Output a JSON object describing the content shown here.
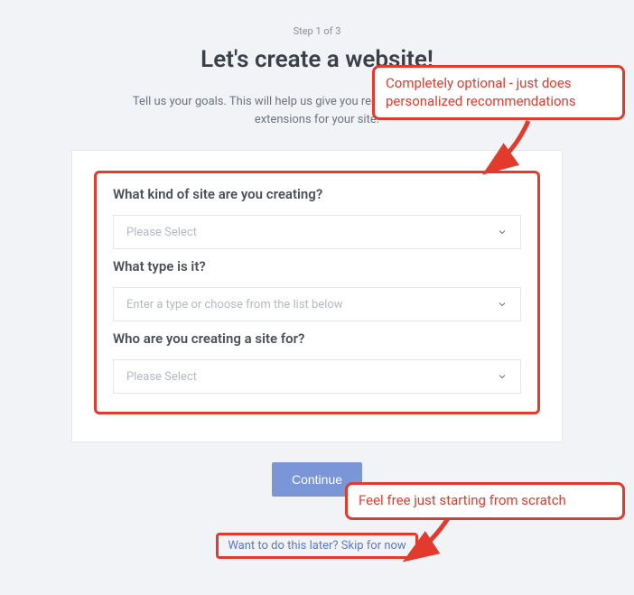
{
  "step_indicator": "Step 1 of 3",
  "page_title": "Let's create a website!",
  "page_subtitle": "Tell us your goals. This will help us give you recommended themes and extensions for your site.",
  "form": {
    "q1": {
      "label": "What kind of site are you creating?",
      "placeholder": "Please Select"
    },
    "q2": {
      "label": "What type is it?",
      "placeholder": "Enter a type or choose from the list below"
    },
    "q3": {
      "label": "Who are you creating a site for?",
      "placeholder": "Please Select"
    }
  },
  "continue_label": "Continue",
  "skip_link": "Want to do this later? Skip for now",
  "annotations": {
    "optional_note": "Completely optional - just does personalized recommendations",
    "skip_note": "Feel free just starting from scratch"
  }
}
